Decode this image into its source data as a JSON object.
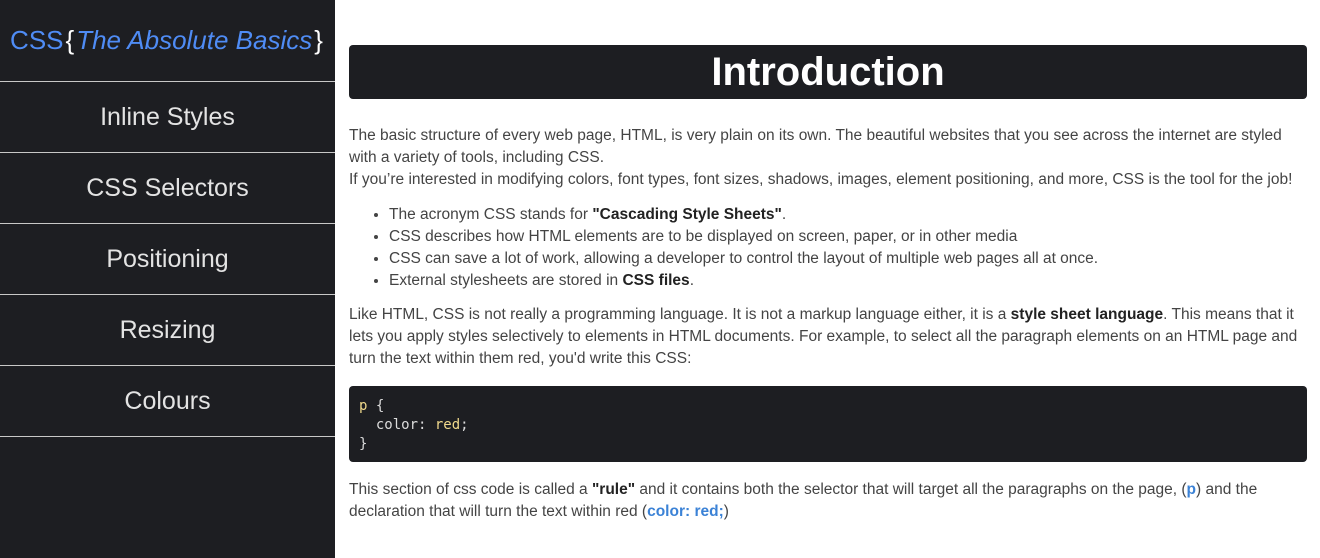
{
  "brand": {
    "css": "CSS",
    "open_brace": "{",
    "subtitle": "The Absolute Basics",
    "close_brace": "}"
  },
  "nav": {
    "items": [
      {
        "label": "Inline Styles"
      },
      {
        "label": "CSS Selectors"
      },
      {
        "label": "Positioning"
      },
      {
        "label": "Resizing"
      },
      {
        "label": "Colours"
      }
    ]
  },
  "main": {
    "heading": "Introduction",
    "p1": "The basic structure of every web page, HTML, is very plain on its own. The beautiful websites that you see across the internet are styled with a variety of tools, including CSS.",
    "p2": "If you’re interested in modifying colors, font types, font sizes, shadows, images, element positioning, and more, CSS is the tool for the job!",
    "list": [
      {
        "pre": "The acronym CSS stands for ",
        "bold": "\"Cascading Style Sheets\"",
        "post": "."
      },
      {
        "text": "CSS describes how HTML elements are to be displayed on screen, paper, or in other media"
      },
      {
        "text": "CSS can save a lot of work, allowing a developer to control the layout of multiple web pages all at once."
      },
      {
        "pre": "External stylesheets are stored in ",
        "bold": "CSS files",
        "post": "."
      }
    ],
    "p3": {
      "pre": "Like HTML, CSS is not really a programming language. It is not a markup language either, it is a ",
      "bold": "style sheet language",
      "post": ". This means that it lets you apply styles selectively to elements in HTML documents. For example, to select all the paragraph elements on an HTML page and turn the text within them red, you'd write this CSS:"
    },
    "code": {
      "selector": "p",
      "open": " {",
      "property": "color",
      "colon": ": ",
      "value": "red",
      "semicolon": ";",
      "close": "}"
    },
    "p4": {
      "pre": "This section of css code is called a ",
      "bold": "\"rule\"",
      "mid": " and it contains both the selector that will target all the paragraphs on the page, (",
      "hl1": "p",
      "mid2": ") and the declaration that will turn the text within red (",
      "hl2": "color: red;",
      "post": ")"
    }
  },
  "colors": {
    "sidebar_bg": "#1d1e22",
    "accent": "#4f8cf5",
    "link": "#3b82d6"
  }
}
